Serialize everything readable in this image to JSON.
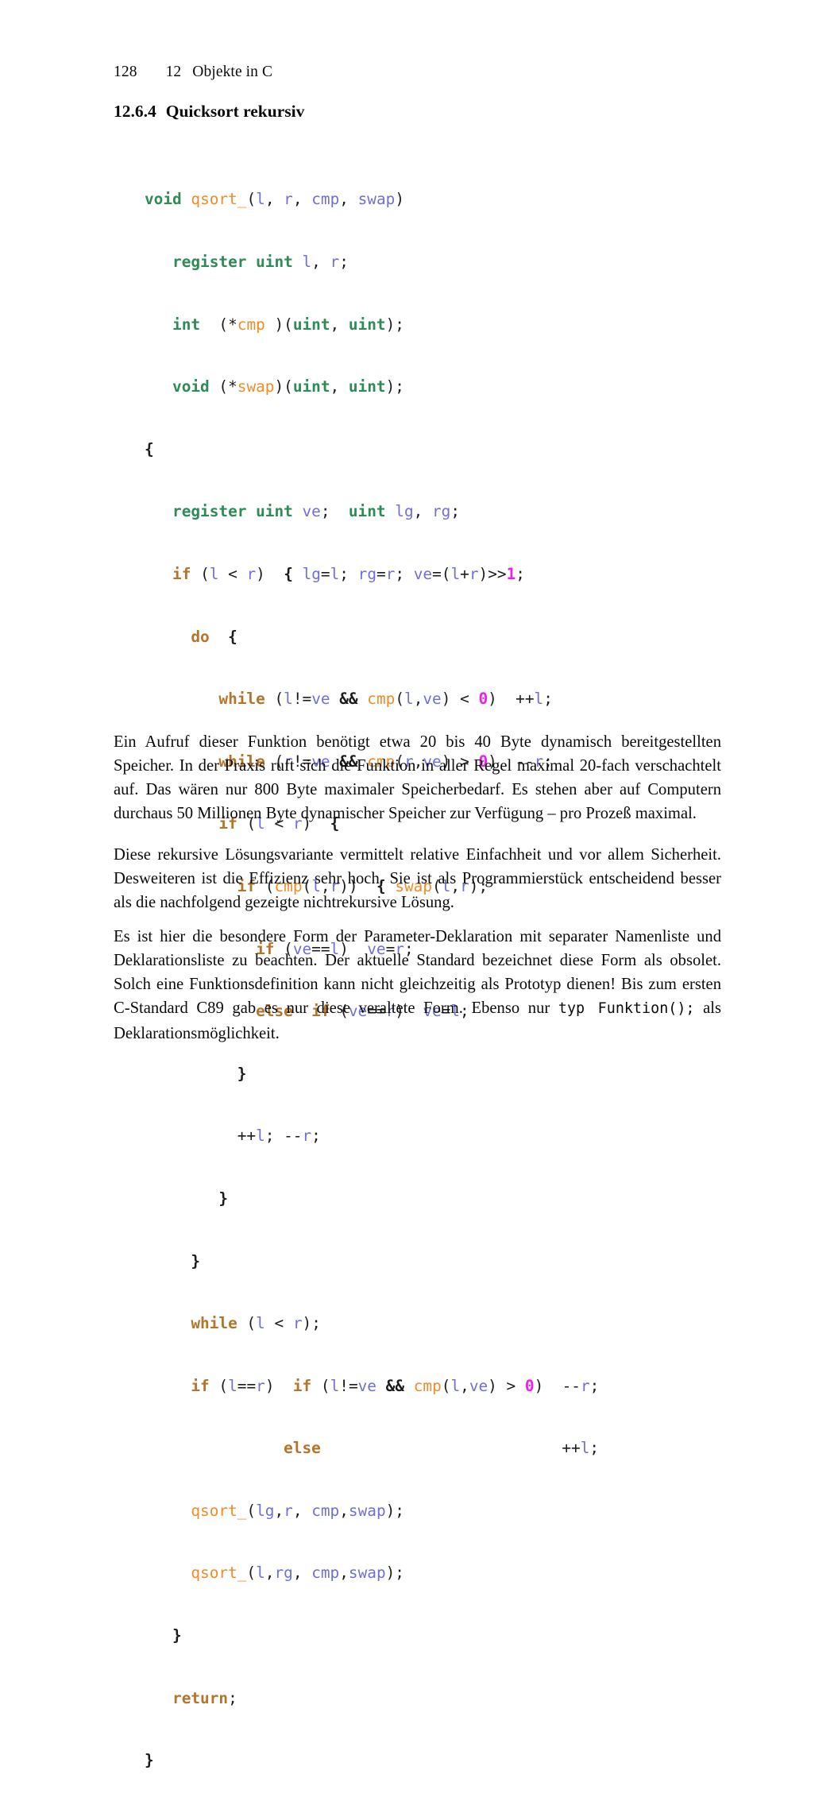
{
  "page": {
    "folio": "128",
    "chapter_number": "12",
    "chapter_title": "Objekte in C"
  },
  "section": {
    "number": "12.6.4",
    "title": "Quicksort rekursiv"
  },
  "code": {
    "language": "C",
    "colors": {
      "type_keyword": "#2e8b57",
      "control_keyword": "#b3742b",
      "function_name": "#ef8c29",
      "identifier": "#6f6fd6",
      "number_literal": "#ec1fec",
      "punctuation": "#1c1c1c"
    },
    "lines": [
      "void qsort_(l, r, cmp, swap)",
      "   register uint l, r;",
      "   int  (*cmp )(uint, uint);",
      "   void (*swap)(uint, uint);",
      "{",
      "   register uint ve;  uint lg, rg;",
      "   if (l < r)  { lg=l; rg=r; ve=(l+r)>>1;",
      "     do  {",
      "        while (l!=ve && cmp(l,ve) < 0)  ++l;",
      "        while (r!=ve && cmp(r,ve) > 0)  --r;",
      "        if (l < r)  {",
      "          if (cmp(l,r))  { swap(l,r);",
      "            if (ve==l)  ve=r;",
      "            else  if (ve==r)  ve=l;",
      "          }",
      "          ++l; --r;",
      "        }",
      "     }",
      "     while (l < r);",
      "     if (l==r)  if (l!=ve && cmp(l,ve) > 0)  --r;",
      "               else                          ++l;",
      "     qsort_(lg,r, cmp,swap);",
      "     qsort_(l,rg, cmp,swap);",
      "   }",
      "   return;",
      "}"
    ]
  },
  "body": {
    "paragraph_1": "Ein Aufruf dieser Funktion benötigt etwa 20 bis 40 Byte dynamisch bereitgestellten Speicher.  In der Praxis ruft sich die Funktion in aller Regel maximal 20-fach verschachtelt auf.  Das wären nur 800 Byte maximaler Speicherbedarf.  Es stehen aber auf Computern durchaus 50 Millionen Byte dynamischer Speicher zur Verfügung – pro Prozeß maximal.",
    "paragraph_2": "Diese rekursive Lösungsvariante vermittelt relative Einfachheit und vor allem Sicherheit.  Desweiteren ist die Effizienz sehr hoch.  Sie ist als Programmierstück entscheidend besser als die nachfolgend gezeigte nichtrekursive Lösung.",
    "paragraph_3_part1": "Es ist hier die besondere Form der Parameter-Deklaration mit separater Namenliste und Deklarationsliste zu beachten.  Der aktuelle Standard bezeichnet diese Form als obsolet.  Solch eine Funktionsdefinition kann nicht gleichzeitig als Prototyp dienen!  Bis zum ersten C-Standard C89 gab es nur diese veraltete Form.  Ebenso nur ",
    "paragraph_3_code": "typ Funktion();",
    "paragraph_3_part2": " als Deklarationsmöglichkeit."
  }
}
